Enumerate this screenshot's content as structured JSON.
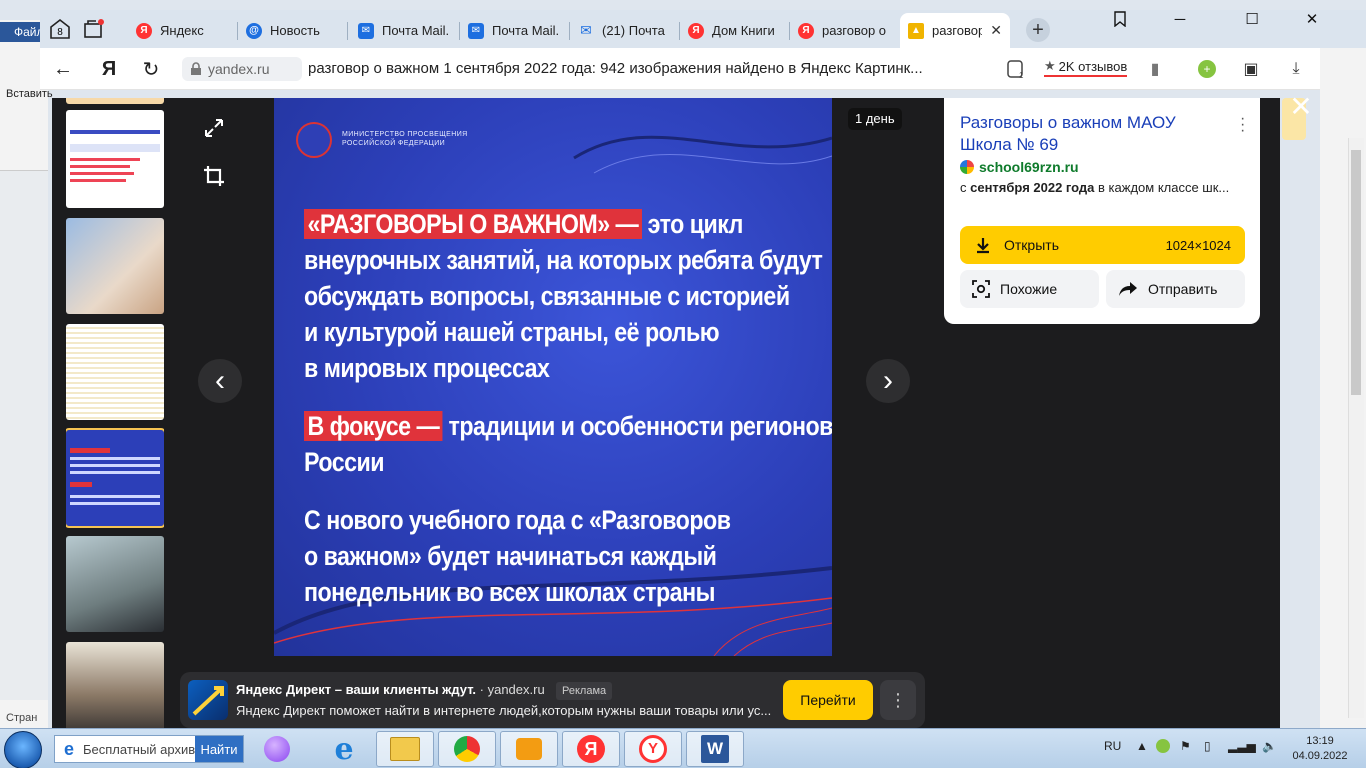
{
  "browser": {
    "tab_counter": "8",
    "tabs": [
      {
        "label": "Яндекс",
        "icon": "yandex-icon",
        "color": "#f33"
      },
      {
        "label": "Новость",
        "icon": "at-icon",
        "color": "#1e6fe0"
      },
      {
        "label": "Почта Mail.ru",
        "icon": "mail-icon",
        "color": "#1e6fe0"
      },
      {
        "label": "Почта Mail.ru",
        "icon": "mail-icon",
        "color": "#1e6fe0"
      },
      {
        "label": "(21) Почта",
        "icon": "envelope-icon",
        "color": "#1e6fe0"
      },
      {
        "label": "Дом Книги",
        "icon": "yandex-icon",
        "color": "#f33"
      },
      {
        "label": "разговор о важном",
        "icon": "yandex-icon",
        "color": "#f33"
      },
      {
        "label": "разговор о важном",
        "icon": "images-icon",
        "color": "#f0b400"
      }
    ],
    "address": {
      "domain": "yandex.ru",
      "title": "разговор о важном 1 сентября 2022 года: 942 изображения найдено в Яндекс Картинк...",
      "reviews": "2K отзывов"
    }
  },
  "viewer": {
    "age_badge": "1 день",
    "slide": {
      "ministry": "Министерство просвещения Российской Федерации",
      "p1_highlight": "«РАЗГОВОРЫ О ВАЖНОМ» —",
      "p1_rest": "это цикл",
      "p1_lines": [
        "внеурочных занятий, на которых ребята будут",
        "обсуждать вопросы, связанные с историей",
        "и культурой нашей страны, её ролью",
        "в мировых процессах"
      ],
      "p2_highlight": "В фокусе —",
      "p2_rest": "традиции и особенности регионов",
      "p2_line2": "России",
      "p3_lines": [
        "С нового учебного года с «Разговоров",
        "о важном» будет начинаться каждый",
        "понедельник во всех школах страны"
      ]
    },
    "info": {
      "title": "Разговоры о важном МАОУ Школа № 69",
      "site": "school69rzn.ru",
      "desc_prefix": "с ",
      "desc_bold": "сентября 2022 года",
      "desc_rest": " в каждом классе шк...",
      "open_label": "Открыть",
      "size": "1024×1024",
      "similar_label": "Похожие",
      "share_label": "Отправить"
    },
    "ad": {
      "title": "Яндекс Директ – ваши клиенты ждут.",
      "domain": "· yandex.ru",
      "badge": "Реклама",
      "text": "Яндекс Директ поможет найти в интернете людей,которым нужны ваши товары или ус...",
      "go_label": "Перейти"
    }
  },
  "word_fragments": {
    "file": "Файл",
    "paste": "Вставить",
    "status": "Стран"
  },
  "taskbar": {
    "search_text": "Бесплатный архив",
    "search_go": "Найти",
    "lang": "RU",
    "time": "13:19",
    "date": "04.09.2022"
  }
}
